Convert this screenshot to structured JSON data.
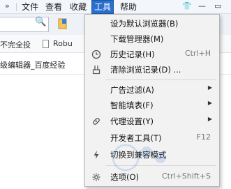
{
  "menubar": {
    "overflow_glyph": "»",
    "items": [
      "文件",
      "查看",
      "收藏",
      "工具",
      "帮助"
    ],
    "active_index": 3,
    "window_controls": [
      "👕",
      "—",
      "▭"
    ]
  },
  "address": {
    "search_glyph": "🔍"
  },
  "bookmarks": {
    "item1": "不完全投",
    "item2": "Robu"
  },
  "tab": {
    "title": "级编辑器_百度经验"
  },
  "tools_menu": {
    "items": [
      {
        "label": "设为默认浏览器(B)",
        "shortcut": "",
        "icon": "",
        "submenu": false
      },
      {
        "label": "下载管理器(M)",
        "shortcut": "",
        "icon": "",
        "submenu": false
      },
      {
        "label": "历史记录(H)",
        "shortcut": "Ctrl+H",
        "icon": "clock-icon",
        "submenu": false
      },
      {
        "label": "清除浏览记录(D) ...",
        "shortcut": "",
        "icon": "broom-icon",
        "submenu": false
      },
      {
        "label": "广告过滤(A)",
        "shortcut": "",
        "icon": "",
        "submenu": true
      },
      {
        "label": "智能填表(F)",
        "shortcut": "",
        "icon": "",
        "submenu": true
      },
      {
        "label": "代理设置(Y)",
        "shortcut": "",
        "icon": "link-icon",
        "submenu": true
      },
      {
        "label": "开发者工具(T)",
        "shortcut": "F12",
        "icon": "",
        "submenu": false
      },
      {
        "label": "切换到兼容模式",
        "shortcut": "",
        "icon": "lightning-icon",
        "submenu": false
      },
      {
        "label": "选项(O)",
        "shortcut": "Ctrl+Shift+S",
        "icon": "gear-icon",
        "submenu": false
      }
    ]
  },
  "colors": {
    "menu_active_bg": "#2b6fce",
    "menu_bg": "#f2f2f2"
  }
}
